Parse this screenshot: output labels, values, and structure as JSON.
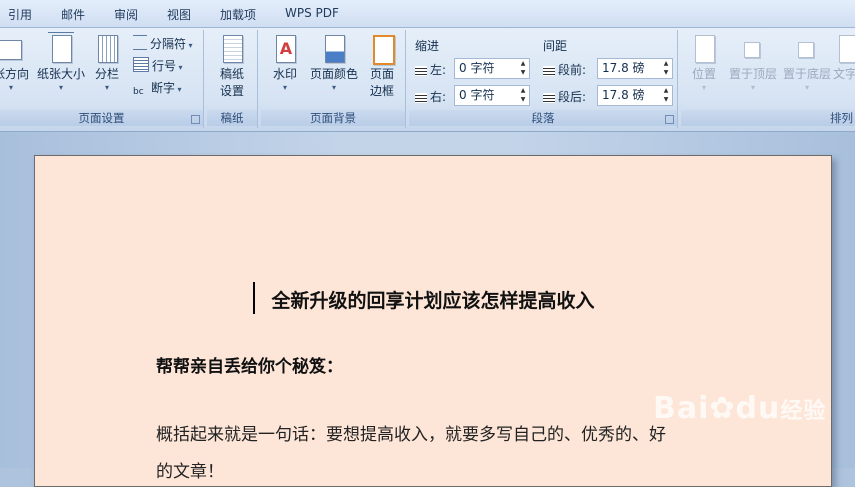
{
  "tabs": [
    "引用",
    "邮件",
    "审阅",
    "视图",
    "加载项",
    "WPS PDF"
  ],
  "page_setup": {
    "orientation": "张方向",
    "size": "纸张大小",
    "columns": "分栏",
    "breaks": "分隔符",
    "line_numbers": "行号",
    "hyphenation": "断字",
    "group_label": "页面设置"
  },
  "manuscript": {
    "button_line1": "稿纸",
    "button_line2": "设置",
    "group_label": "稿纸"
  },
  "page_background": {
    "watermark": "水印",
    "page_color": "页面颜色",
    "borders_line1": "页面",
    "borders_line2": "边框",
    "group_label": "页面背景"
  },
  "paragraph": {
    "indent_header": "缩进",
    "spacing_header": "间距",
    "left_label": "左:",
    "left_value": "0 字符",
    "right_label": "右:",
    "right_value": "0 字符",
    "before_label": "段前:",
    "before_value": "17.8 磅",
    "after_label": "段后:",
    "after_value": "17.8 磅",
    "group_label": "段落"
  },
  "arrange": {
    "position": "位置",
    "bring_front": "置于顶层",
    "send_back": "置于底层",
    "text_wrap": "文字",
    "group_label": "排列"
  },
  "document": {
    "title": "全新升级的回享计划应该怎样提高收入",
    "subtitle": "帮帮亲自丢给你个秘笈：",
    "paragraph": "概括起来就是一句话：要想提高收入，就要多写自己的、优秀的、好",
    "paragraph_cont": "的文章！"
  },
  "watermark": {
    "brand": "Bai",
    "suffix": "du",
    "text": "经验"
  }
}
